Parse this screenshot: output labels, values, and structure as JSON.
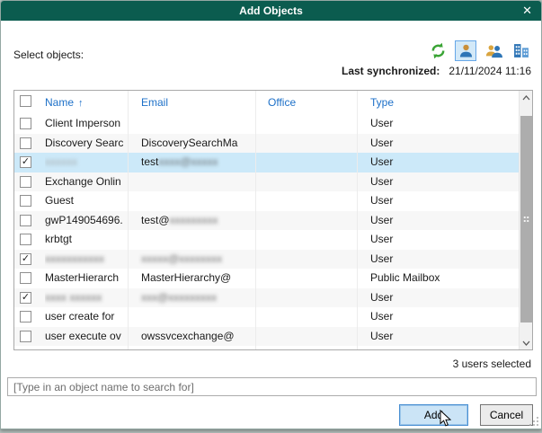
{
  "window": {
    "title": "Add Objects",
    "close_glyph": "✕",
    "titlebar_color": "#0b5c4f"
  },
  "toolbar": {
    "select_label": "Select objects:",
    "icons": [
      {
        "name": "refresh-icon",
        "color": "#3aa435",
        "selected": false
      },
      {
        "name": "user-icon",
        "color": "#2e75b6",
        "selected": true
      },
      {
        "name": "user-group-icon",
        "color": "#2e75b6",
        "selected": false
      },
      {
        "name": "organization-icon",
        "color": "#2e75b6",
        "selected": false
      }
    ],
    "last_sync_label": "Last synchronized:",
    "last_sync_value": "21/11/2024 11:16"
  },
  "table": {
    "columns": [
      "Name",
      "Email",
      "Office",
      "Type"
    ],
    "sort_column": "Name",
    "sort_glyph": "↑",
    "check_glyph": "✓",
    "header_text_color": "#1d70c8",
    "selection_color": "#cce9f9",
    "rows": [
      {
        "checked": false,
        "selected": false,
        "name": "Client Imperson",
        "name_redacted": "",
        "email": "",
        "email_redacted": "",
        "office": "",
        "type": "User"
      },
      {
        "checked": false,
        "selected": false,
        "name": "Discovery Searc",
        "name_redacted": "",
        "email": "DiscoverySearchMa",
        "email_redacted": "",
        "office": "",
        "type": "User"
      },
      {
        "checked": true,
        "selected": true,
        "name": "",
        "name_redacted": "xxxxxx",
        "name_redacted_light": true,
        "email": "test",
        "email_redacted": "xxxx@xxxxx",
        "office": "",
        "type": "User"
      },
      {
        "checked": false,
        "selected": false,
        "name": "Exchange Onlin",
        "name_redacted": "",
        "email": "",
        "email_redacted": "",
        "office": "",
        "type": "User"
      },
      {
        "checked": false,
        "selected": false,
        "name": "Guest",
        "name_redacted": "",
        "email": "",
        "email_redacted": "",
        "office": "",
        "type": "User"
      },
      {
        "checked": false,
        "selected": false,
        "name": "gwP149054696.",
        "name_redacted": "",
        "email": "test@",
        "email_redacted": "xxxxxxxxx",
        "office": "",
        "type": "User"
      },
      {
        "checked": false,
        "selected": false,
        "name": "krbtgt",
        "name_redacted": "",
        "email": "",
        "email_redacted": "",
        "office": "",
        "type": "User"
      },
      {
        "checked": true,
        "selected": false,
        "name": "",
        "name_redacted": "xxxxxxxxxxx",
        "email": "",
        "email_redacted": "xxxxx@xxxxxxxx",
        "office": "",
        "type": "User"
      },
      {
        "checked": false,
        "selected": false,
        "name": "MasterHierarch",
        "name_redacted": "",
        "email": "MasterHierarchy@",
        "email_redacted": "",
        "office": "",
        "type": "Public Mailbox"
      },
      {
        "checked": true,
        "selected": false,
        "name": "",
        "name_redacted": "xxxx xxxxxx",
        "email": "",
        "email_redacted": "xxx@xxxxxxxxx",
        "office": "",
        "type": "User"
      },
      {
        "checked": false,
        "selected": false,
        "name": "user create for",
        "name_redacted": "",
        "email": "",
        "email_redacted": "",
        "office": "",
        "type": "User"
      },
      {
        "checked": false,
        "selected": false,
        "name": "user execute ov",
        "name_redacted": "",
        "email": "owssvcexchange@",
        "email_redacted": "",
        "office": "",
        "type": "User"
      }
    ]
  },
  "footer": {
    "selected_count": "3 users selected",
    "search_placeholder": "[Type in an object name to search for]",
    "add_label": "Add",
    "cancel_label": "Cancel"
  }
}
